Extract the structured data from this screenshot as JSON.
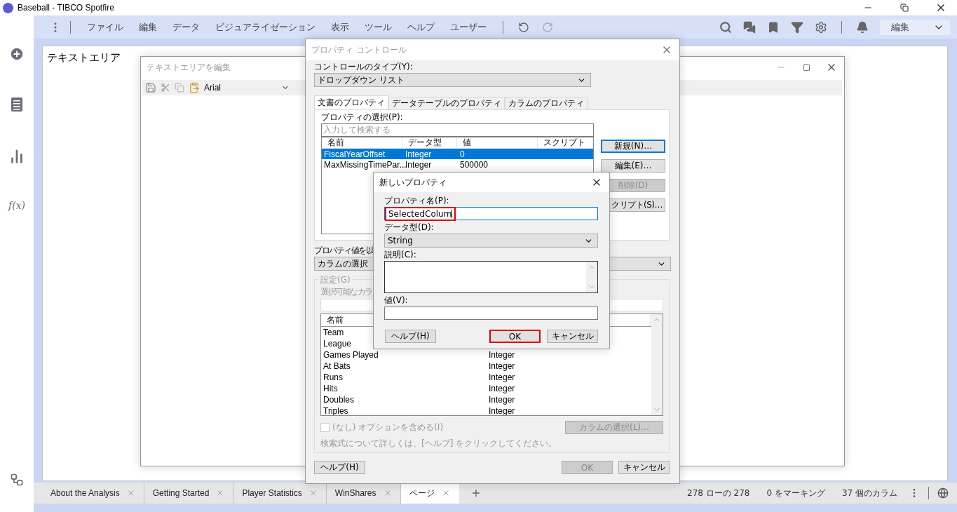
{
  "app": {
    "title": "Baseball - TIBCO Spotfire"
  },
  "menu": {
    "items": [
      "ファイル",
      "編集",
      "データ",
      "ビジュアライゼーション",
      "表示",
      "ツール",
      "ヘルプ",
      "ユーザー"
    ],
    "redo_disabled": true,
    "mode": "編集"
  },
  "rail": {
    "function_label": "f(x)"
  },
  "page": {
    "title": "テキストエリア"
  },
  "text_editor": {
    "title": "テキストエリアを編集",
    "font": "Arial"
  },
  "property_dialog": {
    "title": "プロパティ コントロール",
    "control_type_label": "コントロールのタイプ(Y):",
    "control_type": "ドロップダウン リスト",
    "tabs": [
      {
        "label": "文書のプロパティ",
        "selected": true
      },
      {
        "label": "データテーブルのプロパティ",
        "selected": false
      },
      {
        "label": "カラムのプロパティ",
        "selected": false
      }
    ],
    "select_label": "プロパティの選択(P):",
    "search_placeholder": "入力して検索する",
    "columns": [
      "名前",
      "データ型",
      "値",
      "スクリプト"
    ],
    "rows": [
      {
        "name": "FiscalYearOffset",
        "type": "Integer",
        "value": "0",
        "selected": true
      },
      {
        "name": "MaxMissingTimePar...",
        "type": "Integer",
        "value": "500000",
        "selected": false
      }
    ],
    "side_buttons": [
      {
        "label": "新規(N)…",
        "disabled": false,
        "focused": true
      },
      {
        "label": "編集(E)…",
        "disabled": false,
        "focused": false
      },
      {
        "label": "削除(D)",
        "disabled": true,
        "focused": false
      },
      {
        "label": "クリプト(S)…",
        "disabled": false,
        "focused": false
      }
    ],
    "value_source_label": "プロパティ値を以",
    "value_source": "カラムの選択",
    "settings_legend": "設定(G)",
    "available_label": "選択可能なカラ",
    "column_header": "名前",
    "column_list": [
      {
        "name": "Team"
      },
      {
        "name": "League"
      },
      {
        "name": "Games Played",
        "type": "Integer"
      },
      {
        "name": "At Bats",
        "type": "Integer"
      },
      {
        "name": "Runs",
        "type": "Integer"
      },
      {
        "name": "Hits",
        "type": "Integer"
      },
      {
        "name": "Doubles",
        "type": "Integer"
      },
      {
        "name": "Triples",
        "type": "Integer"
      }
    ],
    "include_none": {
      "label": "(なし) オプションを含める(I)",
      "checked": false,
      "disabled": true
    },
    "select_columns_button": {
      "label": "カラムの選択(L)…",
      "disabled": true
    },
    "hint": "検索式について詳しくは、[ヘルプ] をクリックしてください。",
    "buttons": [
      {
        "label": "ヘルプ(H)",
        "disabled": false
      },
      {
        "label": "OK",
        "disabled": true
      },
      {
        "label": "キャンセル",
        "disabled": false
      }
    ]
  },
  "new_property_dialog": {
    "title": "新しいプロパティ",
    "name_label": "プロパティ名(P):",
    "name_value": "SelectedColum",
    "name_highlighted": true,
    "type_label": "データ型(D):",
    "type": "String",
    "description_label": "説明(C):",
    "value_label": "値(V):",
    "buttons": [
      {
        "label": "ヘルプ(H)",
        "highlighted": false
      },
      {
        "label": "OK",
        "highlighted": true
      },
      {
        "label": "キャンセル",
        "highlighted": false
      }
    ]
  },
  "page_tabs": [
    {
      "label": "About the Analysis",
      "selected": false
    },
    {
      "label": "Getting Started",
      "selected": false
    },
    {
      "label": "Player Statistics",
      "selected": false
    },
    {
      "label": "WinShares",
      "selected": false
    },
    {
      "label": "ページ",
      "selected": true
    }
  ],
  "status": [
    "278 ローの 278",
    "0 をマーキング",
    "37 個のカラム"
  ]
}
